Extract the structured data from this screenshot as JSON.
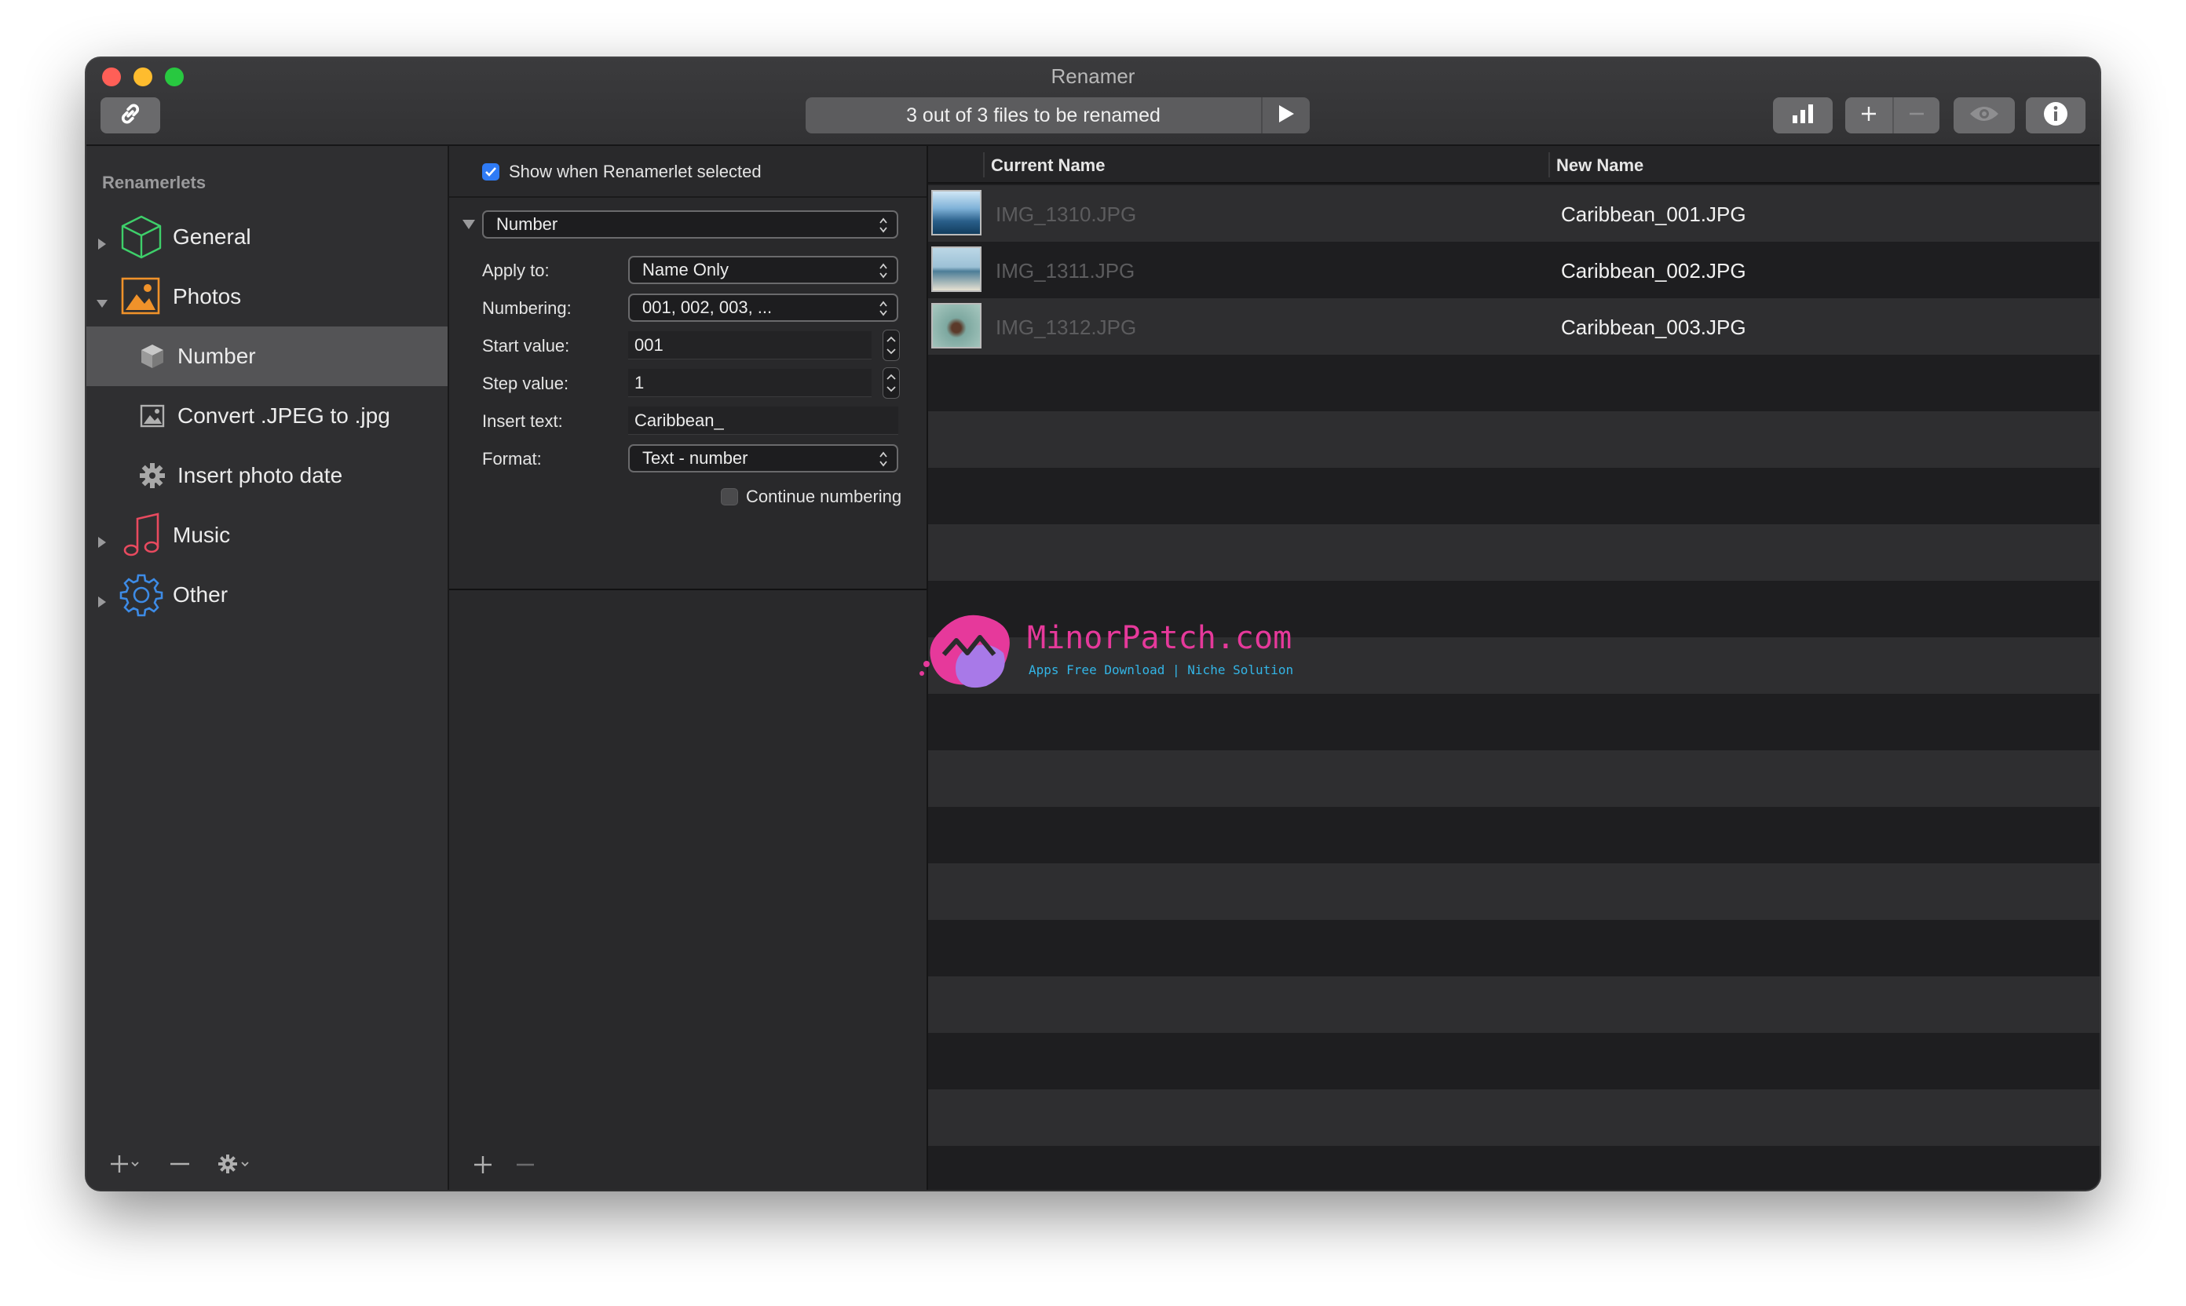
{
  "window": {
    "title": "Renamer",
    "status": "3 out of 3 files to be renamed"
  },
  "sidebar": {
    "heading": "Renamerlets",
    "items": [
      {
        "label": "General",
        "icon": "cube-icon",
        "level": 0,
        "expanded": false
      },
      {
        "label": "Photos",
        "icon": "photo-icon",
        "level": 0,
        "expanded": true
      },
      {
        "label": "Number",
        "icon": "cube-small-icon",
        "level": 1,
        "selected": true
      },
      {
        "label": "Convert .JPEG to .jpg",
        "icon": "image-icon",
        "level": 1
      },
      {
        "label": "Insert photo date",
        "icon": "gear-icon",
        "level": 1
      },
      {
        "label": "Music",
        "icon": "music-note-icon",
        "level": 0,
        "expanded": false
      },
      {
        "label": "Other",
        "icon": "settings-icon",
        "level": 0,
        "expanded": false
      }
    ]
  },
  "settings": {
    "show_when_selected_label": "Show when Renamerlet selected",
    "show_when_selected": true,
    "renamerlet_type": "Number",
    "apply_to_label": "Apply to:",
    "apply_to_value": "Name Only",
    "numbering_label": "Numbering:",
    "numbering_value": "001, 002, 003, ...",
    "start_value_label": "Start value:",
    "start_value": "001",
    "step_value_label": "Step value:",
    "step_value": "1",
    "insert_text_label": "Insert text:",
    "insert_text_value": "Caribbean_",
    "format_label": "Format:",
    "format_value": "Text - number",
    "continue_numbering_label": "Continue numbering",
    "continue_numbering": false
  },
  "filelist": {
    "col_current": "Current Name",
    "col_new": "New Name",
    "files": [
      {
        "current": "IMG_1310.JPG",
        "new": "Caribbean_001.JPG"
      },
      {
        "current": "IMG_1311.JPG",
        "new": "Caribbean_002.JPG"
      },
      {
        "current": "IMG_1312.JPG",
        "new": "Caribbean_003.JPG"
      }
    ]
  },
  "watermark": {
    "title": "MinorPatch.com",
    "subtitle": "Apps Free Download | Niche Solution"
  },
  "colors": {
    "accent": "#2f7bf6",
    "window_bg": "#1e1e20",
    "sidebar_bg": "#2f2f31",
    "selection": "#545456",
    "watermark_pink": "#e6399b",
    "watermark_blue": "#33b5e6"
  }
}
